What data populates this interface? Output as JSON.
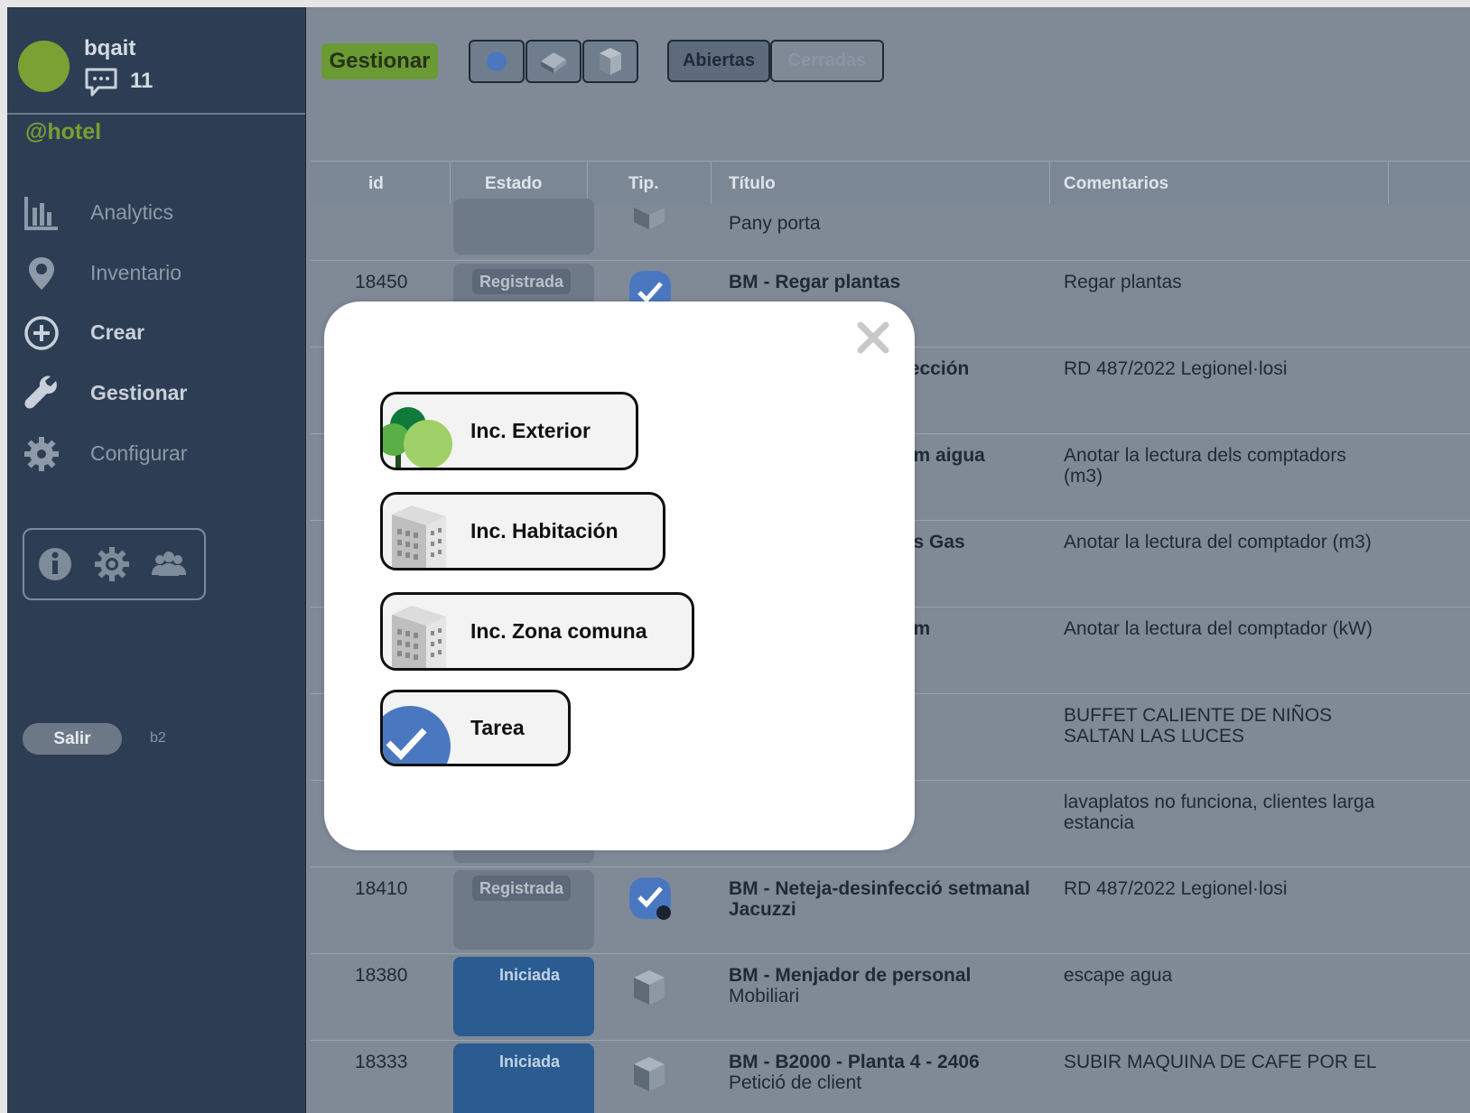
{
  "user": {
    "name": "bqait",
    "messages": "11",
    "org": "@hotel"
  },
  "nav": [
    {
      "label": "Analytics",
      "icon": "bar-chart-icon"
    },
    {
      "label": "Inventario",
      "icon": "location-pin-icon"
    },
    {
      "label": "Crear",
      "icon": "plus-circle-icon"
    },
    {
      "label": "Gestionar",
      "icon": "wrench-icon"
    },
    {
      "label": "Configurar",
      "icon": "gear-icon"
    }
  ],
  "sidebar_footer": {
    "logout_label": "Salir",
    "version": "b2"
  },
  "toolbar": {
    "mode_label": "Gestionar",
    "tab_open": "Abiertas",
    "tab_closed": "Cerradas"
  },
  "table": {
    "headers": [
      "id",
      "Estado",
      "Tip.",
      "Título",
      "Comentarios"
    ],
    "rows": [
      {
        "id": "",
        "status": "",
        "title": "",
        "subtitle": "Pany porta",
        "comment": ""
      },
      {
        "id": "18450",
        "status": "Registrada",
        "title": "BM - Regar plantas",
        "subtitle": "",
        "comment": "Regar plantas"
      },
      {
        "id": "",
        "status": "",
        "title": "nfección",
        "subtitle": "",
        "comment": "RD 487/2022 Legionel·losi"
      },
      {
        "id": "",
        "status": "",
        "title": "sum aigua",
        "subtitle": "",
        "comment": "Anotar la lectura dels comptadors (m3)"
      },
      {
        "id": "",
        "status": "",
        "title": "ıms Gas",
        "subtitle": "",
        "comment": "Anotar la lectura del comptador (m3)"
      },
      {
        "id": "",
        "status": "",
        "title": "sum",
        "subtitle": "",
        "comment": "Anotar la lectura del comptador (kW)"
      },
      {
        "id": "",
        "status": "",
        "title": "",
        "subtitle": "",
        "comment": "BUFFET CALIENTE DE NIÑOS SALTAN LAS LUCES"
      },
      {
        "id": "",
        "status": "",
        "title": "",
        "subtitle": "",
        "comment": "lavaplatos no funciona, clientes larga estancia"
      },
      {
        "id": "18410",
        "status": "Registrada",
        "title": "BM - Neteja-desinfecció setmanal Jacuzzi",
        "subtitle": "",
        "comment": "RD 487/2022 Legionel·losi"
      },
      {
        "id": "18380",
        "status": "Iniciada",
        "title": "BM - Menjador de personal",
        "subtitle": "Mobiliari",
        "comment": "escape agua"
      },
      {
        "id": "18333",
        "status": "Iniciada",
        "title": "BM - B2000 - Planta 4 - 2406",
        "subtitle": "Petició de client",
        "comment": "SUBIR MAQUINA DE CAFE POR EL"
      }
    ]
  },
  "modal": {
    "options": [
      {
        "label": "Inc. Exterior",
        "icon": "trees-icon"
      },
      {
        "label": "Inc. Habitación",
        "icon": "building-icon"
      },
      {
        "label": "Inc. Zona comuna",
        "icon": "building-icon"
      },
      {
        "label": "Tarea",
        "icon": "check-task-icon"
      }
    ]
  },
  "colors": {
    "sidebar": "#2d3e54",
    "accent_green": "#6a9a34",
    "status_blue": "#2a5c91",
    "task_blue": "#4a78c0"
  }
}
